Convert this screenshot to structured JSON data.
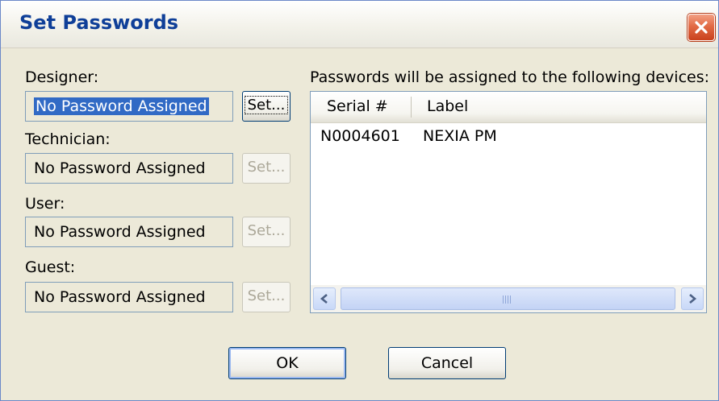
{
  "window": {
    "title": "Set Passwords",
    "close_icon": "close-icon"
  },
  "roles": [
    {
      "label": "Designer:",
      "value": "No Password Assigned",
      "set_label": "Set...",
      "enabled": true
    },
    {
      "label": "Technician:",
      "value": "No Password Assigned",
      "set_label": "Set...",
      "enabled": false
    },
    {
      "label": "User:",
      "value": "No Password Assigned",
      "set_label": "Set...",
      "enabled": false
    },
    {
      "label": "Guest:",
      "value": "No Password Assigned",
      "set_label": "Set...",
      "enabled": false
    }
  ],
  "devices": {
    "caption": "Passwords will be assigned to the following devices:",
    "columns": [
      "Serial #",
      "Label"
    ],
    "rows": [
      {
        "serial": "N0004601",
        "label": "NEXIA PM"
      }
    ],
    "scrollbar": {
      "left_icon": "chevron-left-icon",
      "right_icon": "chevron-right-icon"
    }
  },
  "buttons": {
    "ok": "OK",
    "cancel": "Cancel"
  },
  "colors": {
    "title_text": "#0f3f98",
    "dialog_bg": "#ece9d8",
    "selection": "#316ac5",
    "close_button": "#e26b45"
  }
}
